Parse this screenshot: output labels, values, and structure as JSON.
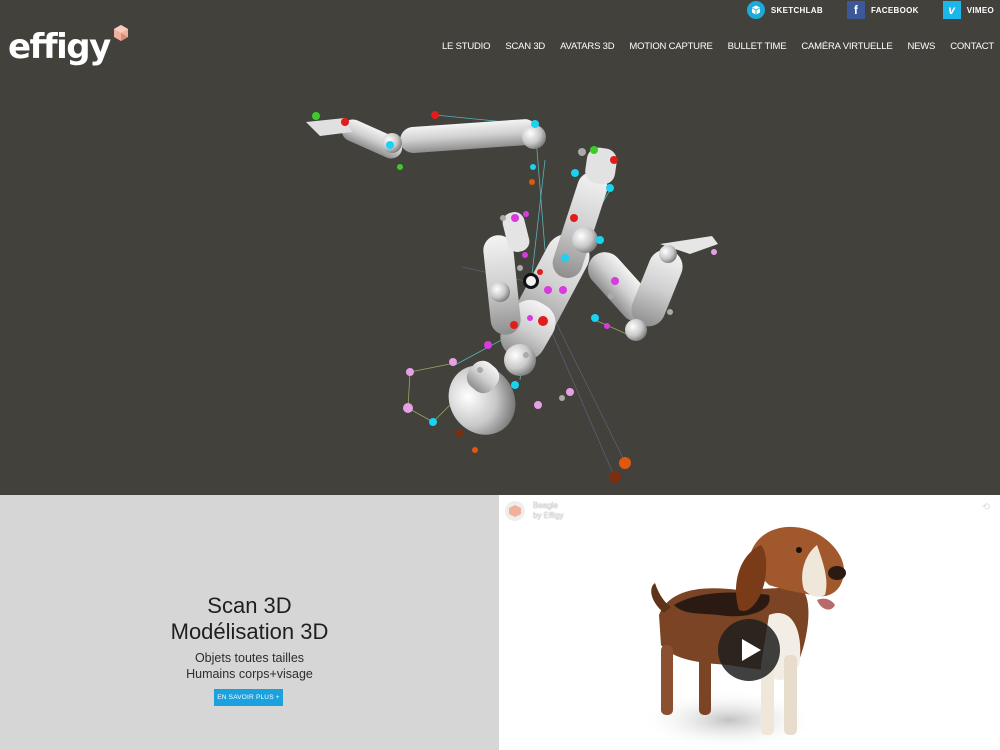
{
  "brand": {
    "logo_text": "effigy"
  },
  "social": [
    {
      "label": "SKETCHLAB",
      "icon": "sketchfab-icon"
    },
    {
      "label": "FACEBOOK",
      "icon": "facebook-icon"
    },
    {
      "label": "VIMEO",
      "icon": "vimeo-icon"
    }
  ],
  "nav": [
    {
      "label": "LE STUDIO"
    },
    {
      "label": "SCAN 3D"
    },
    {
      "label": "AVATARS 3D"
    },
    {
      "label": "MOTION CAPTURE"
    },
    {
      "label": "BULLET TIME"
    },
    {
      "label": "CAMÉRA VIRTUELLE"
    },
    {
      "label": "NEWS"
    },
    {
      "label": "CONTACT"
    }
  ],
  "promo": {
    "title_line1": "Scan 3D",
    "title_line2": "Modélisation 3D",
    "sub_line1": "Objets toutes tailles",
    "sub_line2": "Humains corps+visage",
    "button_label": "EN SAVOIR PLUS +"
  },
  "viewer": {
    "model_name": "Beagle",
    "author": "by Effigy",
    "share_icon": "share-icon",
    "play_icon": "play-icon"
  },
  "colors": {
    "hero_bg": "#42413c",
    "accent": "#1ba1de",
    "promo_bg": "#d6d6d6",
    "marker_cyan": "#19d3f0",
    "marker_red": "#e21b1b",
    "marker_magenta": "#d63ae0",
    "marker_pink": "#e7a0e6",
    "marker_green": "#3ccc2a",
    "marker_orange": "#e0580d"
  }
}
